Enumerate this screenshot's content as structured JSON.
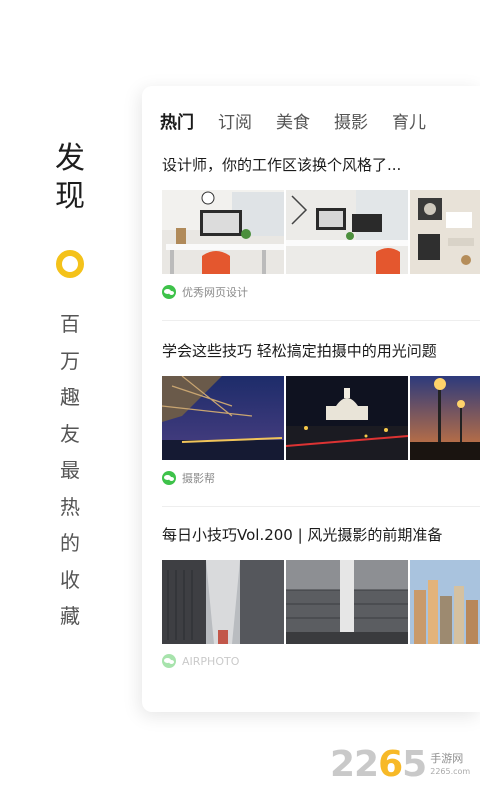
{
  "brand": {
    "title": [
      "发",
      "现"
    ],
    "accent_color": "#f4c21a",
    "slogan": [
      "百",
      "万",
      "趣",
      "友",
      "最",
      "热",
      "的",
      "收",
      "藏"
    ]
  },
  "tabs": [
    {
      "label": "热门",
      "active": true
    },
    {
      "label": "订阅",
      "active": false
    },
    {
      "label": "美食",
      "active": false
    },
    {
      "label": "摄影",
      "active": false
    },
    {
      "label": "育儿",
      "active": false
    }
  ],
  "articles": [
    {
      "title": "设计师，你的工作区该换个风格了...",
      "source": "优秀网页设计",
      "source_icon": "wechat-icon",
      "thumbs": [
        "desk-workspace-photo",
        "desk-workspace-photo-2",
        "desk-overhead-photo"
      ]
    },
    {
      "title": "学会这些技巧 轻松搞定拍摄中的用光问题",
      "source": "摄影帮",
      "source_icon": "wechat-icon",
      "thumbs": [
        "bridge-night-photo",
        "capitol-night-photo",
        "street-lamp-dusk-photo"
      ]
    },
    {
      "title": "每日小技巧Vol.200 | 风光摄影的前期准备",
      "source": "AIRPHOTO",
      "source_icon": "wechat-icon",
      "thumbs": [
        "city-street-photo",
        "skyscraper-bw-photo",
        "city-skyline-photo"
      ]
    }
  ],
  "watermark": {
    "number_gray": "22",
    "number_accent": "6",
    "number_tail": "5",
    "text_cn": "手游网",
    "url": "2265.com"
  }
}
